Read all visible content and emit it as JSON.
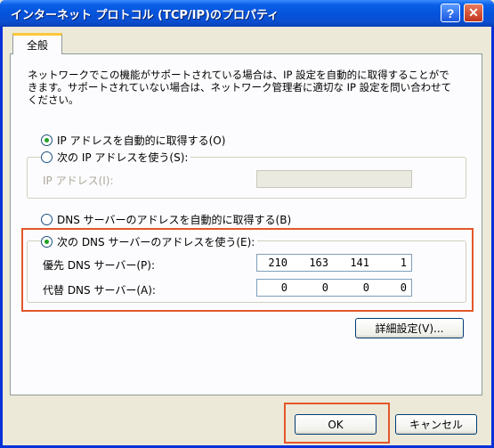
{
  "window": {
    "title": "インターネット プロトコル (TCP/IP)のプロパティ",
    "help_glyph": "?",
    "close_glyph": "✕"
  },
  "tab": {
    "label": "全般"
  },
  "description": "ネットワークでこの機能がサポートされている場合は、IP 設定を自動的に取得することができます。サポートされていない場合は、ネットワーク管理者に適切な IP 設定を問い合わせてください。",
  "ip_section": {
    "auto_label": "IP アドレスを自動的に取得する(O)",
    "manual_label": "次の IP アドレスを使う(S):",
    "ip_address_label": "IP アドレス(I):",
    "auto_selected": true
  },
  "dns_section": {
    "auto_label": "DNS サーバーのアドレスを自動的に取得する(B)",
    "manual_label": "次の DNS サーバーのアドレスを使う(E):",
    "manual_selected": true,
    "preferred_label": "優先 DNS サーバー(P):",
    "preferred_octets": [
      "210",
      "163",
      "141",
      "1"
    ],
    "alternate_label": "代替 DNS サーバー(A):",
    "alternate_octets": [
      "0",
      "0",
      "0",
      "0"
    ]
  },
  "buttons": {
    "advanced": "詳細設定(V)...",
    "ok": "OK",
    "cancel": "キャンセル"
  },
  "colors": {
    "titlebar": "#0553dc",
    "highlight": "#e2572a",
    "radio_dot": "#21a121"
  }
}
